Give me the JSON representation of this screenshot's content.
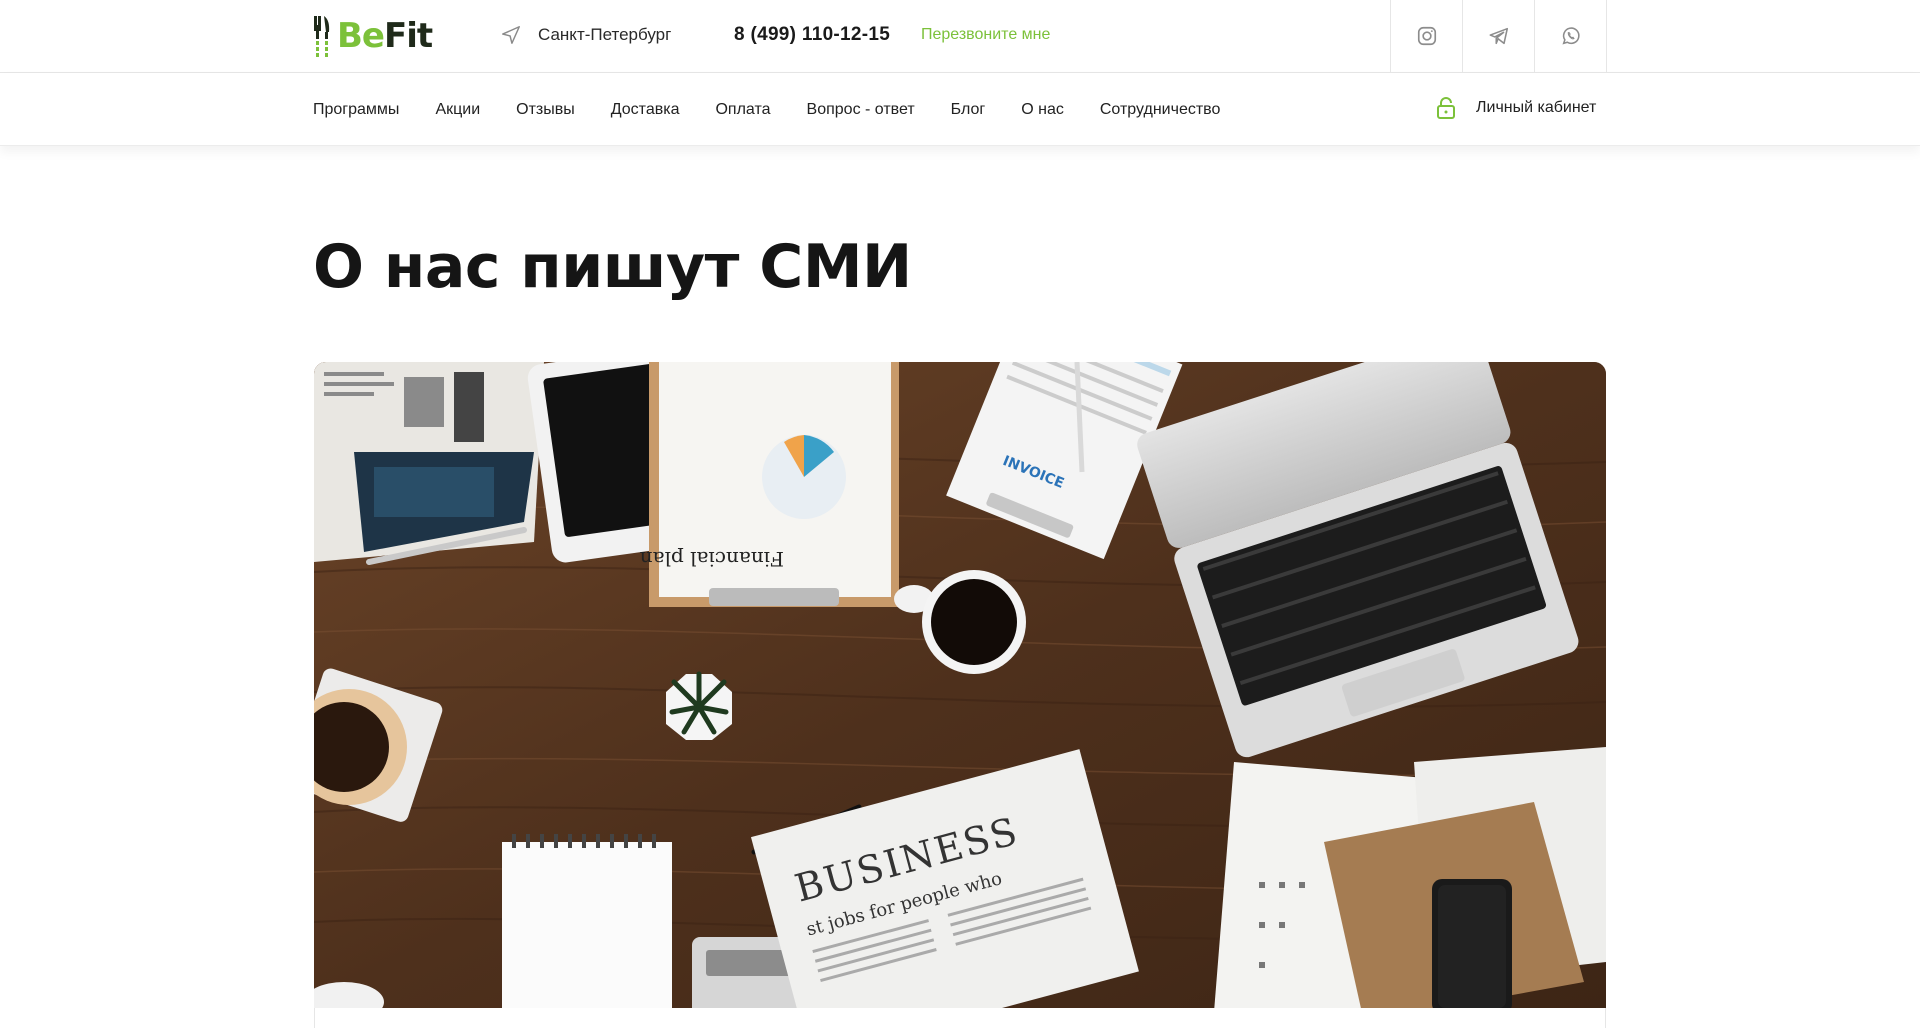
{
  "brand": {
    "name_part1": "Be",
    "name_part2": "Fit",
    "accent_color": "#7cc13a"
  },
  "header": {
    "city": "Санкт-Петербург",
    "city_icon": "navigation-arrow-icon",
    "phone": "8 (499) 110-12-15",
    "callback_label": "Перезвоните мне",
    "socials": [
      {
        "name": "instagram-icon"
      },
      {
        "name": "telegram-icon"
      },
      {
        "name": "whatsapp-icon"
      }
    ]
  },
  "nav": {
    "items": [
      "Программы",
      "Акции",
      "Отзывы",
      "Доставка",
      "Оплата",
      "Вопрос - ответ",
      "Блог",
      "О нас",
      "Сотрудничество"
    ],
    "cabinet_label": "Личный кабинет",
    "cabinet_icon": "lock-icon"
  },
  "main": {
    "title": "О нас пишут СМИ",
    "hero_labels": {
      "financial_plan": "Financial plan",
      "business": "BUSINESS",
      "headline": "st jobs for people who",
      "invoice": "INVOICE"
    }
  }
}
